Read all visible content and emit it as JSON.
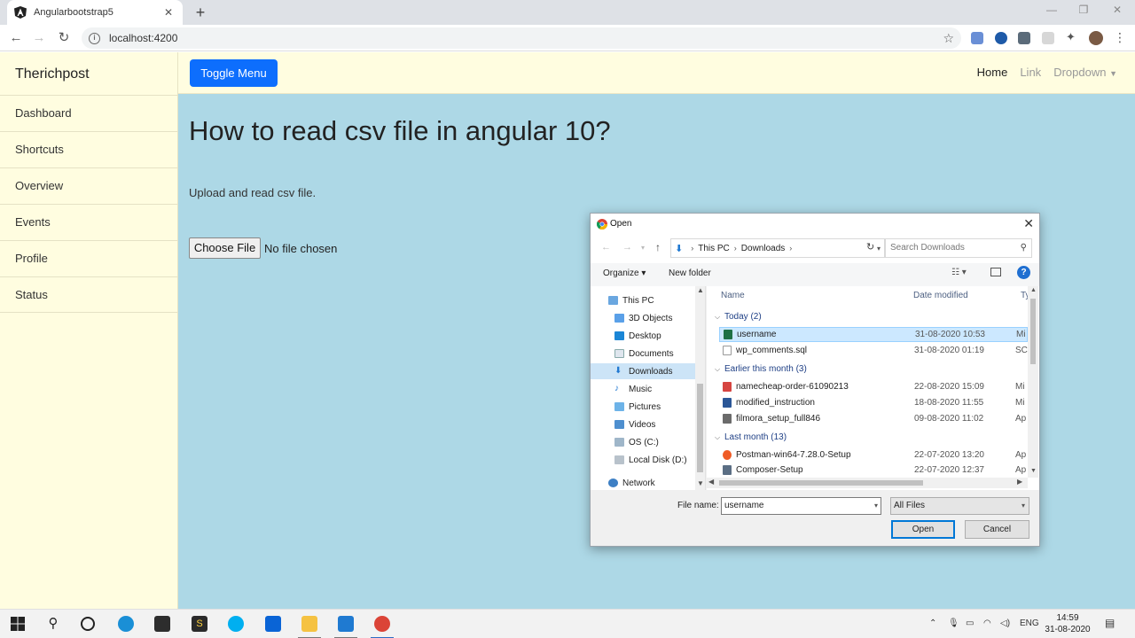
{
  "browser": {
    "tab_title": "Angularbootstrap5",
    "url": "localhost:4200"
  },
  "sidebar": {
    "brand": "Therichpost",
    "items": [
      "Dashboard",
      "Shortcuts",
      "Overview",
      "Events",
      "Profile",
      "Status"
    ]
  },
  "topnav": {
    "toggle_label": "Toggle Menu",
    "links": {
      "home": "Home",
      "link": "Link",
      "dropdown": "Dropdown"
    }
  },
  "main": {
    "title": "How to read csv file in angular 10?",
    "text": "Upload and read csv file.",
    "choose_file": "Choose File",
    "no_file": "No file chosen"
  },
  "dialog": {
    "title": "Open",
    "path": [
      "This PC",
      "Downloads"
    ],
    "search_placeholder": "Search Downloads",
    "organize": "Organize ▾",
    "new_folder": "New folder",
    "nav_items": [
      "This PC",
      "3D Objects",
      "Desktop",
      "Documents",
      "Downloads",
      "Music",
      "Pictures",
      "Videos",
      "OS (C:)",
      "Local Disk (D:)",
      "Network"
    ],
    "columns": {
      "name": "Name",
      "date": "Date modified",
      "type": "Ty"
    },
    "groups": [
      "Today (2)",
      "Earlier this month (3)",
      "Last month (13)"
    ],
    "files": [
      {
        "name": "username",
        "date": "31-08-2020 10:53",
        "type": "Mi"
      },
      {
        "name": "wp_comments.sql",
        "date": "31-08-2020 01:19",
        "type": "SC"
      },
      {
        "name": "namecheap-order-61090213",
        "date": "22-08-2020 15:09",
        "type": "Mi"
      },
      {
        "name": "modified_instruction",
        "date": "18-08-2020 11:55",
        "type": "Mi"
      },
      {
        "name": "filmora_setup_full846",
        "date": "09-08-2020 11:02",
        "type": "Ap"
      },
      {
        "name": "Postman-win64-7.28.0-Setup",
        "date": "22-07-2020 13:20",
        "type": "Ap"
      },
      {
        "name": "Composer-Setup",
        "date": "22-07-2020 12:37",
        "type": "Ap"
      }
    ],
    "file_name_label": "File name:",
    "file_name_value": "username",
    "file_type": "All Files",
    "open_btn": "Open",
    "cancel_btn": "Cancel"
  },
  "taskbar": {
    "lang": "ENG",
    "time": "14:59",
    "date": "31-08-2020"
  },
  "colors": {
    "accent": "#0d6efd",
    "sidebar_bg": "#fffde0",
    "main_bg": "#add8e6",
    "selection": "#cce8ff"
  }
}
